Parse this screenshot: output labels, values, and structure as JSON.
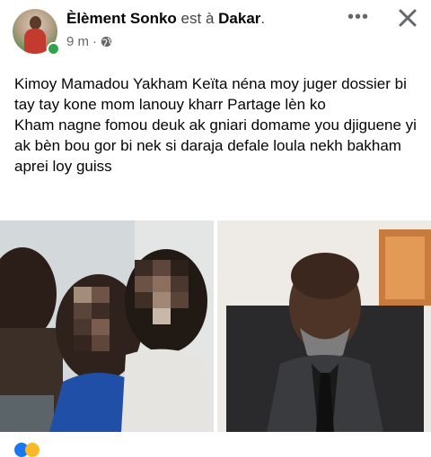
{
  "post": {
    "author": "Èlèment Sonko",
    "location_prefix": "est à",
    "location": "Dakar",
    "location_suffix": ".",
    "time": "9 m",
    "separator": "·",
    "privacy_icon": "globe-icon",
    "more_label": "•••",
    "close_icon": "close-icon",
    "text_paragraphs": [
      "Kimoy Mamadou Yakham Keïta néna moy juger dossier bi tay tay kone mom lanouy kharr Partage lèn ko",
      "Kham nagne fomou deuk ak gniari domame you djiguene yi ak bèn bou gor bi nek si daraja defale loula nekh bakham aprei loy guiss"
    ]
  },
  "colors": {
    "online": "#31a24c",
    "meta_text": "#65676b",
    "text": "#050505"
  }
}
